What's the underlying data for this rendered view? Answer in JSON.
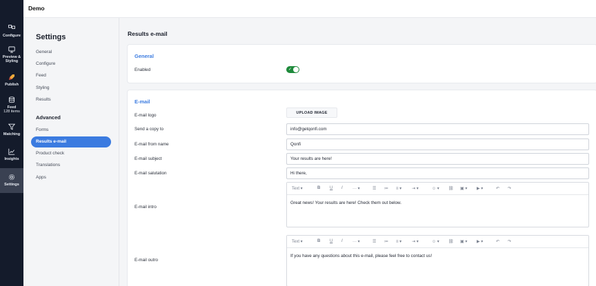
{
  "app": {
    "title": "Demo"
  },
  "rail": {
    "items": [
      {
        "label": "Configure",
        "icon": "configure-icon"
      },
      {
        "label": "Preview & Styling",
        "icon": "monitor-icon"
      },
      {
        "label": "Publish",
        "icon": "rocket-icon"
      },
      {
        "label": "Feed",
        "sublabel": "128 items",
        "icon": "database-icon"
      },
      {
        "label": "Matching",
        "icon": "filter-icon"
      },
      {
        "label": "Insights",
        "icon": "chart-icon"
      },
      {
        "label": "Settings",
        "icon": "gear-icon",
        "active": true
      }
    ]
  },
  "settings": {
    "title": "Settings",
    "items": [
      "General",
      "Configure",
      "Feed",
      "Styling",
      "Results"
    ],
    "advanced_title": "Advanced",
    "advanced_items": [
      "Forms",
      "Results e-mail",
      "Product check",
      "Translations",
      "Apps"
    ],
    "active": "Results e-mail"
  },
  "main": {
    "title": "Results e-mail",
    "general": {
      "heading": "General",
      "enabled_label": "Enabled",
      "enabled": true
    },
    "email": {
      "heading": "E-mail",
      "logo_label": "E-mail logo",
      "upload_label": "UPLOAD IMAGE",
      "copy_label": "Send a copy to",
      "copy_value": "info@getqonfi.com",
      "from_label": "E-mail from name",
      "from_value": "Qonfi",
      "subject_label": "E-mail subject",
      "subject_value": "Your results are here!",
      "salutation_label": "E-mail salutation",
      "salutation_value": "Hi there,",
      "intro_label": "E-mail intro",
      "intro_value": "Great news! Your results are here! Check them out below.",
      "outro_label": "E-mail outro",
      "outro_value": "If you have any questions about this e-mail, please feel free to contact us!",
      "toolbar_text": "Text"
    }
  },
  "colors": {
    "accent": "#3b7be0",
    "toggle_on": "#1e8a3b",
    "rail": "#141b2b"
  }
}
